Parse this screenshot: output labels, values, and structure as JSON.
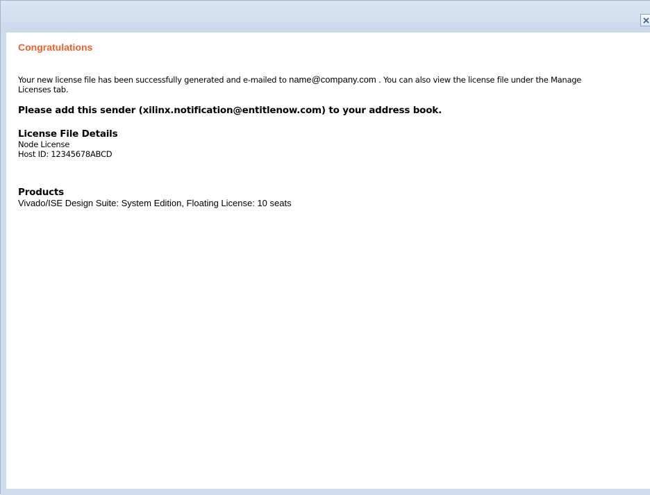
{
  "dialog": {
    "close_label": "×",
    "heading": "Congratulations",
    "message_before": "Your new license file has been successfully generated and e-mailed to ",
    "email": "name@company.com",
    "message_after": " . You can also view the license file under the Manage Licenses tab.",
    "notice": "Please add this sender (xilinx.notification@entitlenow.com) to your address book.",
    "license_details": {
      "title": "License File Details",
      "type": "Node License",
      "host_id": "Host ID: 12345678ABCD"
    },
    "products": {
      "title": "Products",
      "items": [
        "Vivado/ISE Design Suite: System Edition, Floating License: 10 seats"
      ]
    }
  },
  "colors": {
    "heading": "#f05f27",
    "frame": "#cfdcee"
  },
  "icons": {
    "close": "close-icon"
  }
}
